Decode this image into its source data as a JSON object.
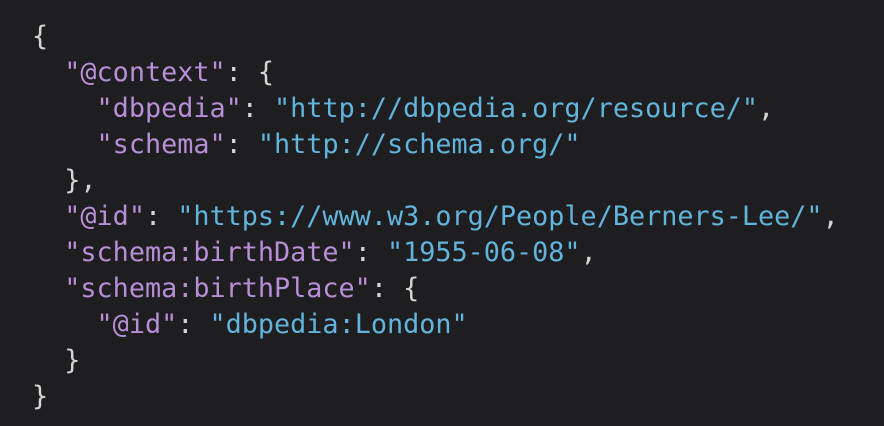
{
  "colors": {
    "background": "#1e1e20",
    "punctuation": "#d4d4d4",
    "key": "#b88ed6",
    "string": "#62b4dc"
  },
  "code": {
    "lines": [
      [
        {
          "t": "punct",
          "v": "{"
        }
      ],
      [
        {
          "t": "punct",
          "v": "  "
        },
        {
          "t": "key",
          "v": "\"@context\""
        },
        {
          "t": "punct",
          "v": ": {"
        }
      ],
      [
        {
          "t": "punct",
          "v": "    "
        },
        {
          "t": "key",
          "v": "\"dbpedia\""
        },
        {
          "t": "punct",
          "v": ": "
        },
        {
          "t": "str",
          "v": "\"http://dbpedia.org/resource/\""
        },
        {
          "t": "punct",
          "v": ","
        }
      ],
      [
        {
          "t": "punct",
          "v": "    "
        },
        {
          "t": "key",
          "v": "\"schema\""
        },
        {
          "t": "punct",
          "v": ": "
        },
        {
          "t": "str",
          "v": "\"http://schema.org/\""
        }
      ],
      [
        {
          "t": "punct",
          "v": "  },"
        }
      ],
      [
        {
          "t": "punct",
          "v": "  "
        },
        {
          "t": "key",
          "v": "\"@id\""
        },
        {
          "t": "punct",
          "v": ": "
        },
        {
          "t": "str",
          "v": "\"https://www.w3.org/People/Berners-Lee/\""
        },
        {
          "t": "punct",
          "v": ","
        }
      ],
      [
        {
          "t": "punct",
          "v": "  "
        },
        {
          "t": "key",
          "v": "\"schema:birthDate\""
        },
        {
          "t": "punct",
          "v": ": "
        },
        {
          "t": "str",
          "v": "\"1955-06-08\""
        },
        {
          "t": "punct",
          "v": ","
        }
      ],
      [
        {
          "t": "punct",
          "v": "  "
        },
        {
          "t": "key",
          "v": "\"schema:birthPlace\""
        },
        {
          "t": "punct",
          "v": ": {"
        }
      ],
      [
        {
          "t": "punct",
          "v": "    "
        },
        {
          "t": "key",
          "v": "\"@id\""
        },
        {
          "t": "punct",
          "v": ": "
        },
        {
          "t": "str",
          "v": "\"dbpedia:London\""
        }
      ],
      [
        {
          "t": "punct",
          "v": "  }"
        }
      ],
      [
        {
          "t": "punct",
          "v": "}"
        }
      ]
    ]
  }
}
